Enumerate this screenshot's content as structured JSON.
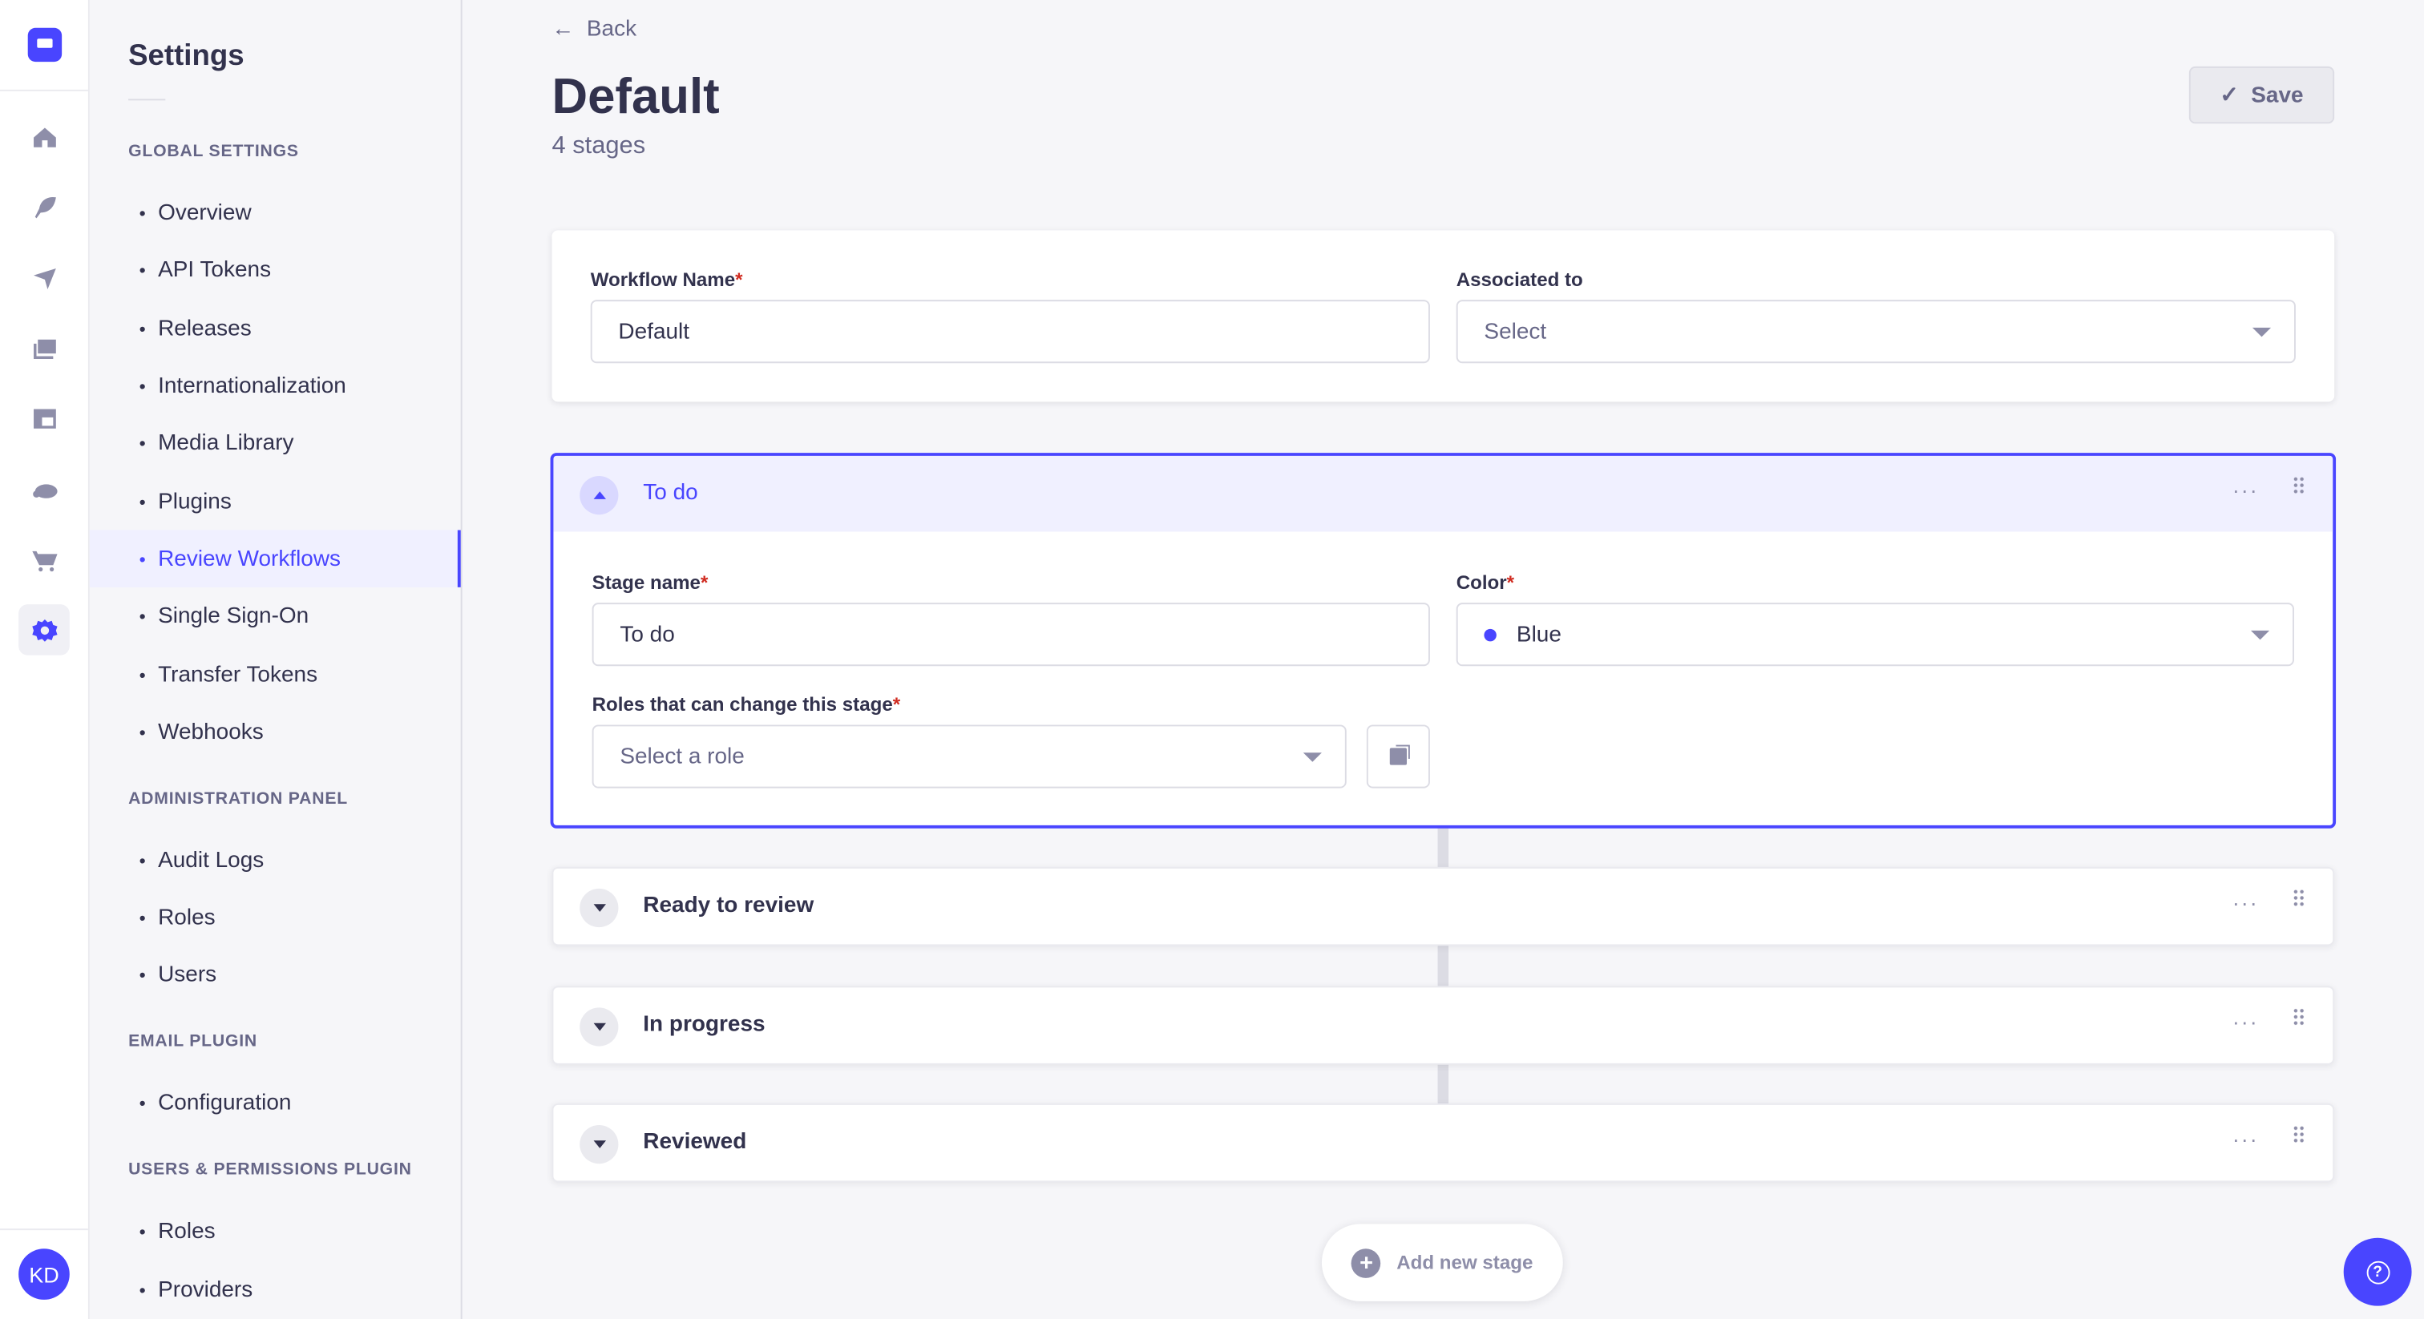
{
  "colors": {
    "accent": "#4945ff",
    "stage_color": "#4945ff"
  },
  "nav": {
    "icons": [
      "home-icon",
      "feather-icon",
      "paper-plane-icon",
      "images-icon",
      "layout-icon",
      "cloud-icon",
      "cart-icon",
      "gear-icon"
    ],
    "avatar": "KD"
  },
  "sidebar": {
    "title": "Settings",
    "sections": [
      {
        "header": "Global Settings",
        "items": [
          "Overview",
          "API Tokens",
          "Releases",
          "Internationalization",
          "Media Library",
          "Plugins",
          "Review Workflows",
          "Single Sign-On",
          "Transfer Tokens",
          "Webhooks"
        ]
      },
      {
        "header": "Administration Panel",
        "items": [
          "Audit Logs",
          "Roles",
          "Users"
        ]
      },
      {
        "header": "Email Plugin",
        "items": [
          "Configuration"
        ]
      },
      {
        "header": "Users & Permissions Plugin",
        "items": [
          "Roles",
          "Providers"
        ]
      }
    ],
    "active": "Review Workflows"
  },
  "header": {
    "back": "Back",
    "title": "Default",
    "subtitle": "4 stages",
    "save": "Save"
  },
  "workflow": {
    "name_label": "Workflow Name",
    "name_value": "Default",
    "assoc_label": "Associated to",
    "assoc_placeholder": "Select"
  },
  "stages": [
    {
      "name": "To do",
      "expanded": true,
      "stage_name_label": "Stage name",
      "stage_name_value": "To do",
      "color_label": "Color",
      "color_value": "Blue",
      "roles_label": "Roles that can change this stage",
      "roles_placeholder": "Select a role"
    },
    {
      "name": "Ready to review"
    },
    {
      "name": "In progress"
    },
    {
      "name": "Reviewed"
    }
  ],
  "more": "···",
  "add_stage": "Add new stage",
  "required_mark": "*"
}
